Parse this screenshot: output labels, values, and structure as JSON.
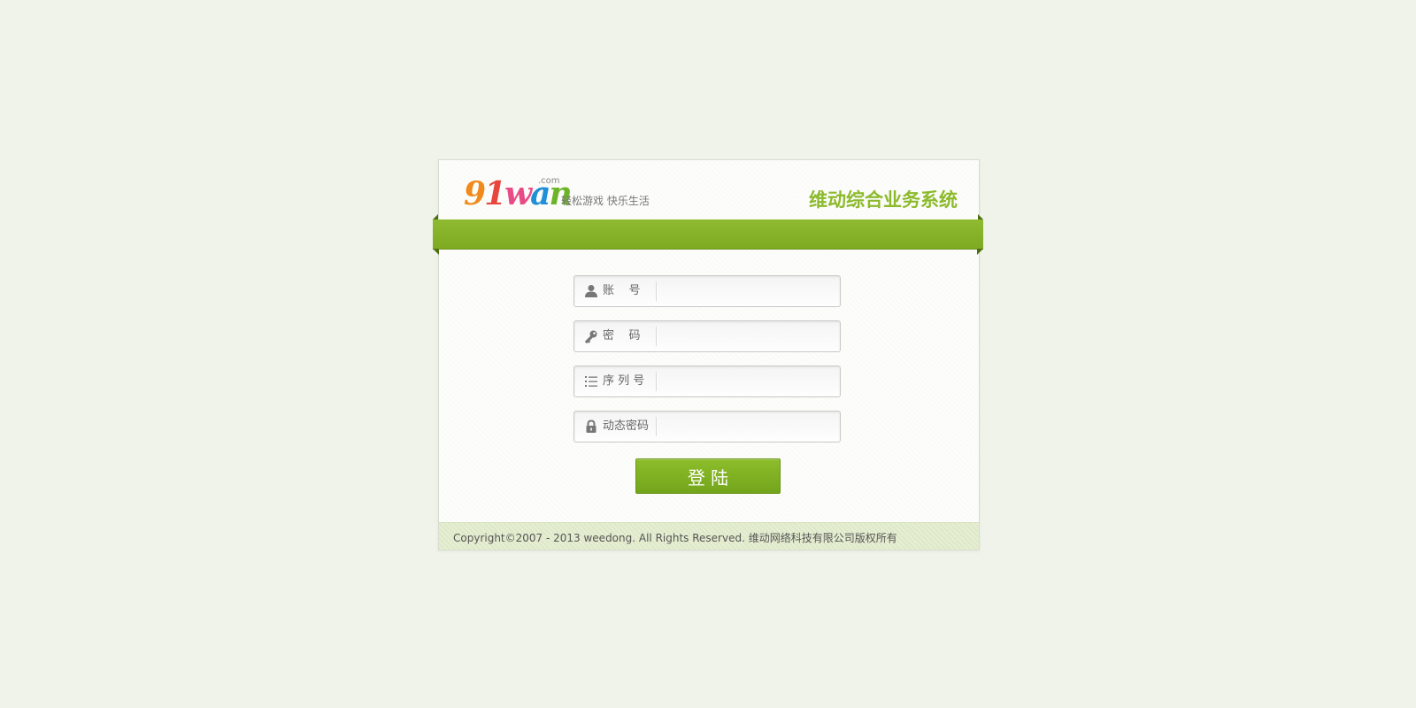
{
  "header": {
    "logo_digits_9": "9",
    "logo_digits_1": "1",
    "logo_w": "w",
    "logo_a": "a",
    "logo_n": "n",
    "logo_com": ".com",
    "slogan": "轻松游戏  快乐生活",
    "system_title": "维动综合业务系统"
  },
  "form": {
    "fields": [
      {
        "label": "账    号",
        "icon": "user-icon",
        "value": ""
      },
      {
        "label": "密    码",
        "icon": "key-icon",
        "value": ""
      },
      {
        "label": "序 列 号",
        "icon": "list-icon",
        "value": ""
      },
      {
        "label": "动态密码",
        "icon": "lock-icon",
        "value": ""
      }
    ],
    "submit_label": "登  陆"
  },
  "footer": {
    "copyright": "Copyright©2007 - 2013 weedong. All Rights Reserved. 维动网络科技有限公司版权所有"
  },
  "colors": {
    "accent": "#8cba2c",
    "background": "#f0f3ea"
  }
}
